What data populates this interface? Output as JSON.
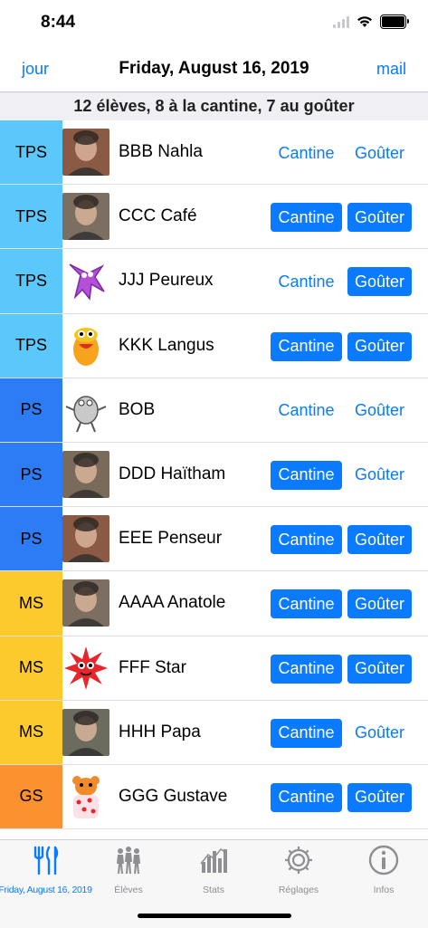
{
  "status_bar": {
    "time": "8:44"
  },
  "nav": {
    "left": "jour",
    "title": "Friday, August 16, 2019",
    "right": "mail"
  },
  "summary": "12 élèves, 8 à la cantine, 7 au goûter",
  "colors": {
    "accent": "#0a7aff",
    "TPS": "#5ac8fa",
    "PS": "#2c7cf6",
    "MS": "#fdca2e",
    "GS": "#fb922f"
  },
  "buttons": {
    "cantine": "Cantine",
    "gouter": "Goûter"
  },
  "students": [
    {
      "level": "TPS",
      "name": "BBB Nahla",
      "avatar": "photo-icon",
      "cantine": false,
      "gouter": false
    },
    {
      "level": "TPS",
      "name": "CCC Café",
      "avatar": "photo-icon",
      "cantine": true,
      "gouter": true
    },
    {
      "level": "TPS",
      "name": "JJJ Peureux",
      "avatar": "purple-monster-icon",
      "cantine": false,
      "gouter": true
    },
    {
      "level": "TPS",
      "name": "KKK Langus",
      "avatar": "orange-monster-icon",
      "cantine": true,
      "gouter": true
    },
    {
      "level": "PS",
      "name": "BOB",
      "avatar": "gray-monster-icon",
      "cantine": false,
      "gouter": false
    },
    {
      "level": "PS",
      "name": "DDD Haïtham",
      "avatar": "photo-icon",
      "cantine": true,
      "gouter": false
    },
    {
      "level": "PS",
      "name": "EEE Penseur",
      "avatar": "photo-icon",
      "cantine": true,
      "gouter": true
    },
    {
      "level": "MS",
      "name": "AAAA Anatole",
      "avatar": "photo-icon",
      "cantine": true,
      "gouter": true
    },
    {
      "level": "MS",
      "name": "FFF Star",
      "avatar": "red-star-icon",
      "cantine": true,
      "gouter": true
    },
    {
      "level": "MS",
      "name": "HHH Papa",
      "avatar": "photo-icon",
      "cantine": true,
      "gouter": false
    },
    {
      "level": "GS",
      "name": "GGG Gustave",
      "avatar": "bear-icon",
      "cantine": true,
      "gouter": true
    }
  ],
  "tabs": [
    {
      "label": "Friday, August 16, 2019",
      "icon": "fork-knife-icon",
      "active": true
    },
    {
      "label": "Élèves",
      "icon": "people-icon",
      "active": false
    },
    {
      "label": "Stats",
      "icon": "bar-chart-icon",
      "active": false
    },
    {
      "label": "Réglages",
      "icon": "gear-icon",
      "active": false
    },
    {
      "label": "Infos",
      "icon": "info-icon",
      "active": false
    }
  ]
}
